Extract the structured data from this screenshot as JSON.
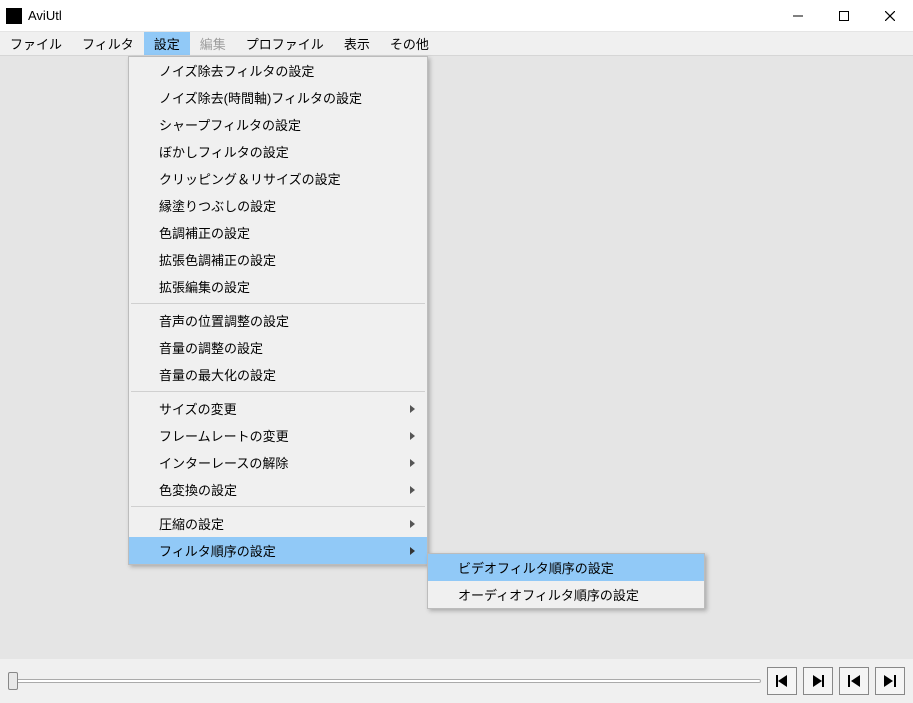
{
  "title": "AviUtl",
  "menubar": {
    "file": "ファイル",
    "filter": "フィルタ",
    "settings": "設定",
    "edit": "編集",
    "profile": "プロファイル",
    "view": "表示",
    "other": "その他"
  },
  "dropdown": {
    "noise_filter": "ノイズ除去フィルタの設定",
    "noise_time_filter": "ノイズ除去(時間軸)フィルタの設定",
    "sharp_filter": "シャープフィルタの設定",
    "blur_filter": "ぼかしフィルタの設定",
    "clip_resize": "クリッピング＆リサイズの設定",
    "edge_fill": "縁塗りつぶしの設定",
    "color_correction": "色調補正の設定",
    "ext_color_correction": "拡張色調補正の設定",
    "ext_edit": "拡張編集の設定",
    "audio_position": "音声の位置調整の設定",
    "volume_adjust": "音量の調整の設定",
    "volume_max": "音量の最大化の設定",
    "resize": "サイズの変更",
    "framerate": "フレームレートの変更",
    "deinterlace": "インターレースの解除",
    "color_convert": "色変換の設定",
    "compression": "圧縮の設定",
    "filter_order": "フィルタ順序の設定"
  },
  "submenu": {
    "video_filter_order": "ビデオフィルタ順序の設定",
    "audio_filter_order": "オーディオフィルタ順序の設定"
  }
}
